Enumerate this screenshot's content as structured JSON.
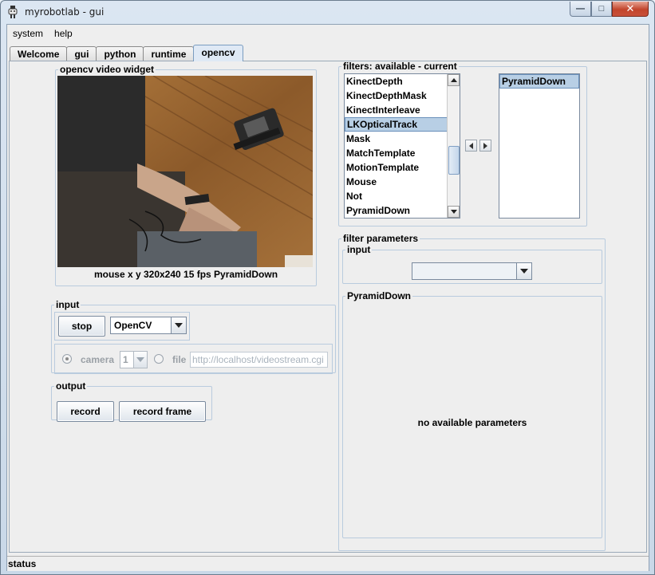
{
  "window": {
    "title": "myrobotlab - gui",
    "min_glyph": "—",
    "max_glyph": "□",
    "close_glyph": "✕"
  },
  "menu": [
    "system",
    "help"
  ],
  "tabs": [
    {
      "label": "Welcome",
      "active": false
    },
    {
      "label": "gui",
      "active": false
    },
    {
      "label": "python",
      "active": false
    },
    {
      "label": "runtime",
      "active": false
    },
    {
      "label": "opencv",
      "active": true
    }
  ],
  "video_widget": {
    "legend": "opencv  video widget",
    "caption": "mouse x y  320x240  15 fps  PyramidDown"
  },
  "input": {
    "legend": "input",
    "stop_label": "stop",
    "grabber_value": "OpenCV",
    "camera_label": "camera",
    "camera_index": "1",
    "file_label": "file",
    "file_url": "http://localhost/videostream.cgi"
  },
  "output": {
    "legend": "output",
    "record_label": "record",
    "record_frame_label": "record frame"
  },
  "filters": {
    "legend": "filters: available - current",
    "available": [
      "KinectDepth",
      "KinectDepthMask",
      "KinectInterleave",
      "LKOpticalTrack",
      "Mask",
      "MatchTemplate",
      "MotionTemplate",
      "Mouse",
      "Not",
      "PyramidDown"
    ],
    "selected_available": "LKOpticalTrack",
    "current": [
      "PyramidDown"
    ]
  },
  "filter_parameters": {
    "legend": "filter parameters",
    "input_legend": "input",
    "input_value": "",
    "filter_legend": "PyramidDown",
    "message": "no available parameters"
  },
  "status": "status",
  "icons": {
    "app": "robot-icon",
    "minimize": "minimize-icon",
    "maximize": "maximize-icon",
    "close": "close-icon"
  },
  "colors": {
    "selection": "#b8cfe5",
    "close_button": "#c2452c",
    "panel": "#eeeeee"
  }
}
